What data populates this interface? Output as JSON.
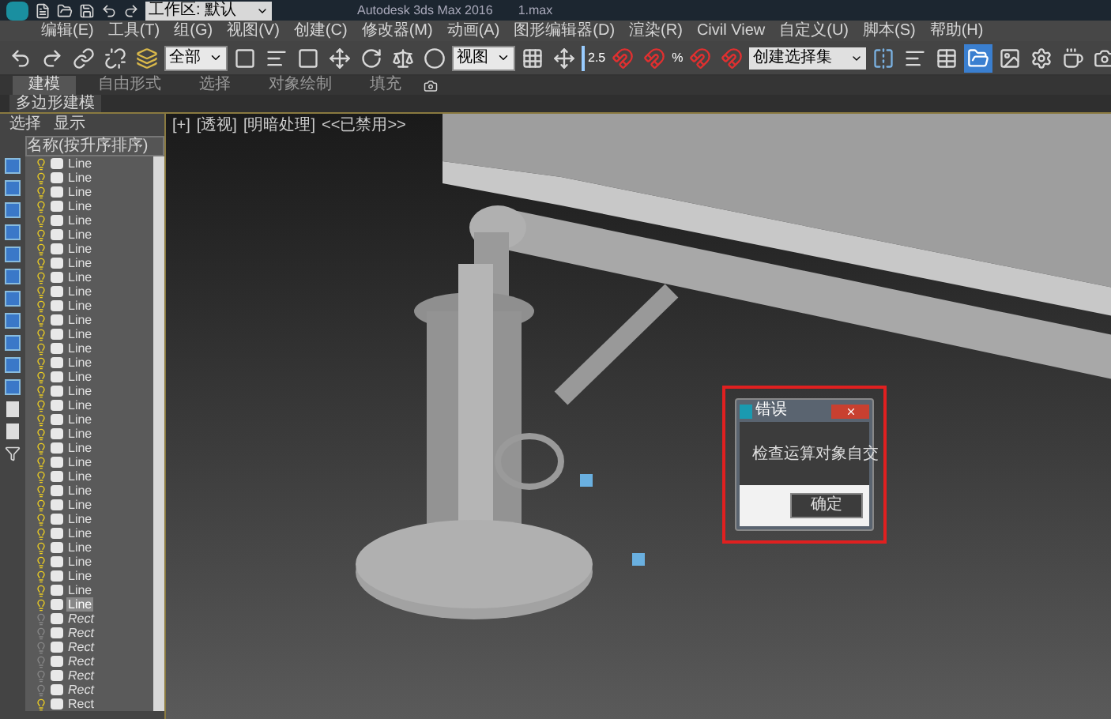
{
  "title_bar": {
    "workspace": "工作区: 默认",
    "app_title": "Autodesk 3ds Max 2016",
    "file_name": "1.max"
  },
  "menu": [
    "编辑(E)",
    "工具(T)",
    "组(G)",
    "视图(V)",
    "创建(C)",
    "修改器(M)",
    "动画(A)",
    "图形编辑器(D)",
    "渲染(R)",
    "Civil View",
    "自定义(U)",
    "脚本(S)",
    "帮助(H)"
  ],
  "toolbar": {
    "selection_filter": "全部",
    "reference_coord": "视图",
    "snap_angle": "2.5",
    "percent_snap": "%",
    "selection_set": "创建选择集"
  },
  "ribbon": {
    "tabs": [
      {
        "label": "建模",
        "selected": true
      },
      {
        "label": "自由形式",
        "selected": false
      },
      {
        "label": "选择",
        "selected": false
      },
      {
        "label": "对象绘制",
        "selected": false
      },
      {
        "label": "填充",
        "selected": false
      }
    ],
    "panel": "多边形建模"
  },
  "explorer": {
    "tabs": [
      "选择",
      "显示"
    ],
    "column": "名称(按升序排序)",
    "rows": [
      {
        "name": "Line",
        "hidden": false,
        "selected": false
      },
      {
        "name": "Line",
        "hidden": false,
        "selected": false
      },
      {
        "name": "Line",
        "hidden": false,
        "selected": false
      },
      {
        "name": "Line",
        "hidden": false,
        "selected": false
      },
      {
        "name": "Line",
        "hidden": false,
        "selected": false
      },
      {
        "name": "Line",
        "hidden": false,
        "selected": false
      },
      {
        "name": "Line",
        "hidden": false,
        "selected": false
      },
      {
        "name": "Line",
        "hidden": false,
        "selected": false
      },
      {
        "name": "Line",
        "hidden": false,
        "selected": false
      },
      {
        "name": "Line",
        "hidden": false,
        "selected": false
      },
      {
        "name": "Line",
        "hidden": false,
        "selected": false
      },
      {
        "name": "Line",
        "hidden": false,
        "selected": false
      },
      {
        "name": "Line",
        "hidden": false,
        "selected": false
      },
      {
        "name": "Line",
        "hidden": false,
        "selected": false
      },
      {
        "name": "Line",
        "hidden": false,
        "selected": false
      },
      {
        "name": "Line",
        "hidden": false,
        "selected": false
      },
      {
        "name": "Line",
        "hidden": false,
        "selected": false
      },
      {
        "name": "Line",
        "hidden": false,
        "selected": false
      },
      {
        "name": "Line",
        "hidden": false,
        "selected": false
      },
      {
        "name": "Line",
        "hidden": false,
        "selected": false
      },
      {
        "name": "Line",
        "hidden": false,
        "selected": false
      },
      {
        "name": "Line",
        "hidden": false,
        "selected": false
      },
      {
        "name": "Line",
        "hidden": false,
        "selected": false
      },
      {
        "name": "Line",
        "hidden": false,
        "selected": false
      },
      {
        "name": "Line",
        "hidden": false,
        "selected": false
      },
      {
        "name": "Line",
        "hidden": false,
        "selected": false
      },
      {
        "name": "Line",
        "hidden": false,
        "selected": false
      },
      {
        "name": "Line",
        "hidden": false,
        "selected": false
      },
      {
        "name": "Line",
        "hidden": false,
        "selected": false
      },
      {
        "name": "Line",
        "hidden": false,
        "selected": false
      },
      {
        "name": "Line",
        "hidden": false,
        "selected": false
      },
      {
        "name": "Line",
        "hidden": false,
        "selected": true
      },
      {
        "name": "Rect",
        "hidden": true,
        "selected": false
      },
      {
        "name": "Rect",
        "hidden": true,
        "selected": false
      },
      {
        "name": "Rect",
        "hidden": true,
        "selected": false
      },
      {
        "name": "Rect",
        "hidden": true,
        "selected": false
      },
      {
        "name": "Rect",
        "hidden": true,
        "selected": false
      },
      {
        "name": "Rect",
        "hidden": true,
        "selected": false
      },
      {
        "name": "Rect",
        "hidden": false,
        "selected": false
      }
    ]
  },
  "viewport": {
    "labels": [
      "[+]",
      "[透视]",
      "[明暗处理]",
      "<<已禁用>>"
    ]
  },
  "dialog": {
    "title": "错误",
    "message": "检查运算对象自交",
    "button": "确定",
    "highlighted": true
  }
}
